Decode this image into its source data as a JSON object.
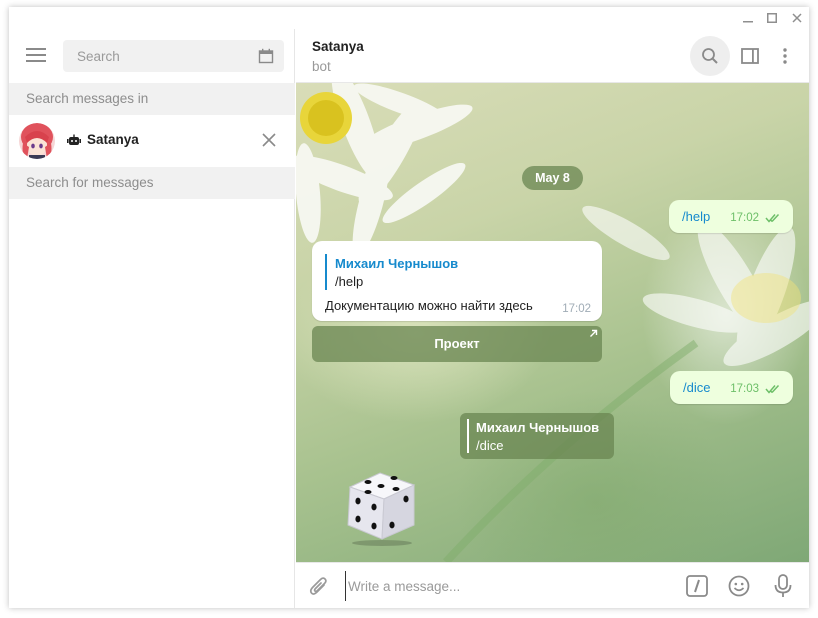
{
  "window": {
    "controls": [
      "minimize",
      "maximize",
      "close"
    ]
  },
  "sidebar": {
    "search_placeholder": "Search",
    "search_in_label": "Search messages in",
    "chat": {
      "name": "Satanya",
      "icon": "bot-icon"
    },
    "search_for_label": "Search for messages"
  },
  "header": {
    "peer_name": "Satanya",
    "peer_status": "bot"
  },
  "messages": {
    "date": "May 8",
    "out1": {
      "text": "/help",
      "time": "17:02"
    },
    "in1": {
      "reply_name": "Михаил Чернышов",
      "reply_text": "/help",
      "text": "Документацию можно найти здесь",
      "time": "17:02"
    },
    "keyboard_button": "Проект",
    "out2": {
      "text": "/dice",
      "time": "17:03"
    },
    "dice_reply": {
      "name": "Михаил Чернышов",
      "text": "/dice"
    }
  },
  "composer": {
    "placeholder": "Write a message..."
  },
  "colors": {
    "accent": "#168acd",
    "outgoing_bubble": "#eeffde",
    "service_bg": "#6a8652",
    "ticks": "#6dbf68"
  }
}
